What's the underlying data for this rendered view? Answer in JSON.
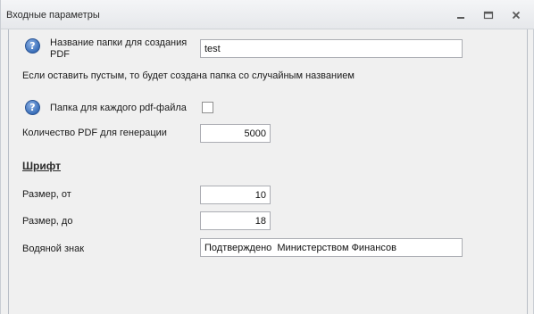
{
  "window": {
    "title": "Входные параметры",
    "controls": {
      "minimize": "minimize-icon",
      "restore": "restore-icon",
      "close": "close-icon"
    }
  },
  "form": {
    "folder_name": {
      "label": "Название папки для создания PDF",
      "label_line1": "Название папки для создания",
      "label_line2": "PDF",
      "value": "test",
      "hint": "Если оставить пустым, то будет создана папка со случайным названием"
    },
    "folder_per_file": {
      "label": "Папка для каждого pdf-файла",
      "checked": false
    },
    "pdf_count": {
      "label": "Количество PDF для генерации",
      "value": "5000"
    },
    "font_section": {
      "heading": "Шрифт",
      "size_from": {
        "label": "Размер, от",
        "value": "10"
      },
      "size_to": {
        "label": "Размер, до",
        "value": "18"
      }
    },
    "watermark": {
      "label": "Водяной знак",
      "value": "Подтверждено  Министерством Финансов"
    }
  },
  "colors": {
    "background": "#f0f0f0",
    "input_border": "#abadb3",
    "help_icon": "#3a6fb9"
  }
}
